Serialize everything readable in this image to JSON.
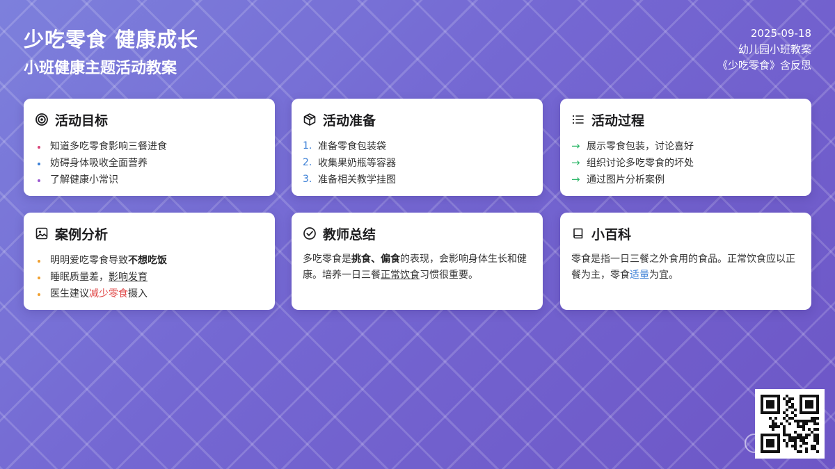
{
  "header": {
    "title": "少吃零食 健康成长",
    "subtitle": "小班健康主题活动教案",
    "date": "2025-09-18",
    "class_label": "幼儿园小班教案",
    "doc_name": "《少吃零食》含反思"
  },
  "cards": {
    "goals": {
      "title": "活动目标",
      "icon": "target-icon",
      "items": [
        "知道多吃零食影响三餐进食",
        "妨碍身体吸收全面营养",
        "了解健康小常识"
      ],
      "bullet_colors": [
        "#d9467a",
        "#3b7fd6",
        "#9b59d0"
      ]
    },
    "prep": {
      "title": "活动准备",
      "icon": "box-icon",
      "items": [
        {
          "num": "1.",
          "text": "准备零食包装袋"
        },
        {
          "num": "2.",
          "text": "收集果奶瓶等容器"
        },
        {
          "num": "3.",
          "text": "准备相关教学挂图"
        }
      ]
    },
    "process": {
      "title": "活动过程",
      "icon": "list-icon",
      "arrow": "→",
      "items": [
        "展示零食包装，讨论喜好",
        "组织讨论多吃零食的坏处",
        "通过图片分析案例"
      ]
    },
    "cases": {
      "title": "案例分析",
      "icon": "image-icon",
      "bullet_color": "#f0a030",
      "item1": {
        "text": "明明爱吃零食导致",
        "bold": "不想吃饭"
      },
      "item2": {
        "text": "睡眠质量差，",
        "underline": "影响发育"
      },
      "item3": {
        "text": "医生建议",
        "red": "减少零食",
        "tail": "摄入"
      }
    },
    "summary": {
      "title": "教师总结",
      "icon": "check-circle-icon",
      "p1": "多吃零食是",
      "bold1": "挑食、偏食",
      "p2": "的表现，会影响身体生长和健康。培养一日三餐",
      "underline": "正常饮食",
      "p3": "习惯很重要。"
    },
    "wiki": {
      "title": "小百科",
      "icon": "book-icon",
      "p1": "零食是指一日三餐之外食用的食品。正常饮食应以正餐为主，零食",
      "blue": "适量",
      "p2": "为宜。"
    }
  },
  "colors": {
    "background_start": "#7d80dc",
    "background_end": "#6d56c6",
    "number_blue": "#3b7fd6",
    "arrow_green": "#2fb86a",
    "accent_red": "#e04848"
  },
  "qr": {
    "icon": "qr-code-icon"
  }
}
